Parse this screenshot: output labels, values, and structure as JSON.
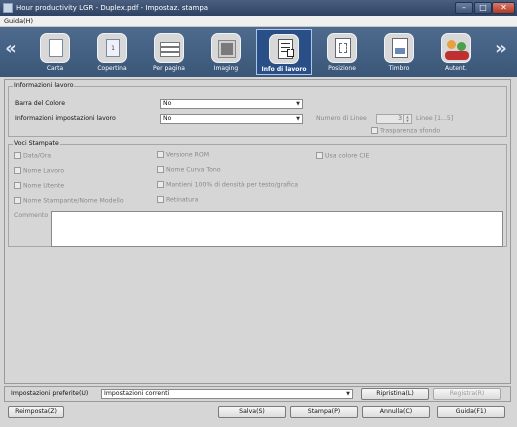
{
  "window": {
    "title": "Hour productivity LGR - Duplex.pdf - Impostaz. stampa",
    "minimize": "–",
    "maximize": "□",
    "close": "✕"
  },
  "menu": {
    "guide": "Guida(H)"
  },
  "toolbar": {
    "prev_arrow": "«",
    "next_arrow": "»",
    "tools": [
      {
        "label": "Carta",
        "icon": "paper-icon"
      },
      {
        "label": "Copertina",
        "icon": "cover-icon"
      },
      {
        "label": "Per pagina",
        "icon": "per-page-icon"
      },
      {
        "label": "Imaging",
        "icon": "imaging-icon"
      },
      {
        "label": "Info di lavoro",
        "icon": "job-info-icon",
        "active": true
      },
      {
        "label": "Posizione",
        "icon": "position-icon"
      },
      {
        "label": "Timbro",
        "icon": "stamp-icon"
      },
      {
        "label": "Autent.",
        "icon": "authentication-icon"
      }
    ]
  },
  "job_info": {
    "legend": "Informazioni lavoro",
    "color_bar_label": "Barra del Colore",
    "color_bar_value": "No",
    "job_settings_label": "Informazioni impostazioni lavoro",
    "job_settings_value": "No",
    "lines_label": "Numero di Linee",
    "lines_value": "3",
    "lines_range": "Linee [1...5]",
    "transparency_label": "Trasparenza sfondo"
  },
  "printed_items": {
    "legend": "Voci Stampate",
    "checkboxes": [
      "Data/Ora",
      "Nome Lavoro",
      "Nome Utente",
      "Nome Stampante/Nome Modello",
      "Versione ROM",
      "Nome Curva Tono",
      "Mantieni 100% di densità per testo/grafica",
      "Retinatura",
      "Usa colore CIE"
    ],
    "comment_label": "Commento"
  },
  "favorites": {
    "label": "Impostazioni preferite(U)",
    "value": "Impostazioni correnti",
    "restore": "Ripristina(L)",
    "register": "Registra(R)"
  },
  "footer": {
    "reset": "Reimposta(Z)",
    "save": "Salva(S)",
    "print": "Stampa(P)",
    "cancel": "Annulla(C)",
    "help": "Guida(F1)"
  },
  "colors": {
    "toolbar_bg": "#3a5677",
    "active_tool": "#2a4f86",
    "panel_bg": "#d6d6d6"
  }
}
